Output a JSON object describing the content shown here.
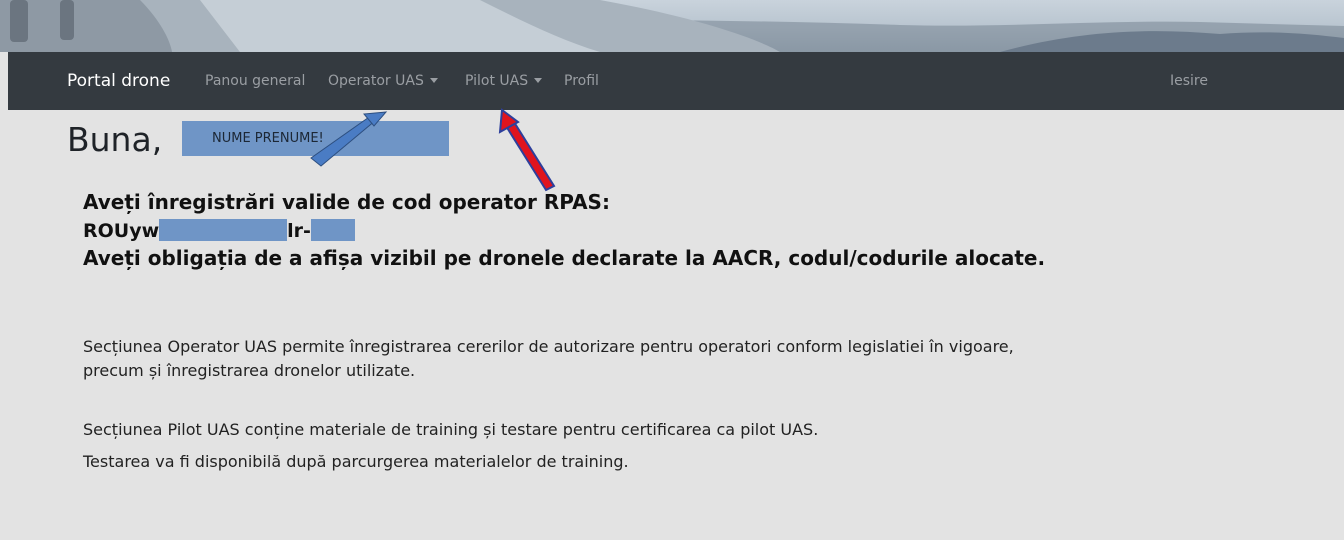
{
  "navbar": {
    "brand": "Portal drone",
    "links": [
      {
        "label": "Panou general"
      },
      {
        "label": "Operator UAS",
        "dropdown": true
      },
      {
        "label": "Pilot UAS",
        "dropdown": true
      },
      {
        "label": "Profil"
      }
    ],
    "logout": "Iesire"
  },
  "greeting": {
    "prefix": "Buna,",
    "name_redacted": "NUME PRENUME!"
  },
  "registration": {
    "heading": "Aveți înregistrări valide de cod operator RPAS:",
    "code_part1": "ROUyw",
    "code_part2": "lr-",
    "notice": "Aveți obligația de a afișa vizibil pe dronele declarate la AACR, codul/codurile alocate."
  },
  "info": {
    "operator_line1": "Secțiunea Operator UAS permite înregistrarea cererilor de autorizare pentru operatori conform legislatiei în vigoare,",
    "operator_line2": "precum și înregistrarea dronelor utilizate.",
    "pilot_line1": "Secțiunea Pilot UAS conține materiale de training și testare pentru certificarea ca pilot UAS.",
    "pilot_line2": "Testarea va fi disponibilă după parcurgerea materialelor de training."
  },
  "colors": {
    "navbar_bg": "#343a40",
    "page_bg": "#e3e3e3",
    "redaction": "#6f95c6",
    "arrow_blue": "#4a7cc4",
    "arrow_red": "#e0141e"
  },
  "icons": [
    "dropdown-caret-icon",
    "blue-annotation-arrow",
    "red-annotation-arrow"
  ]
}
